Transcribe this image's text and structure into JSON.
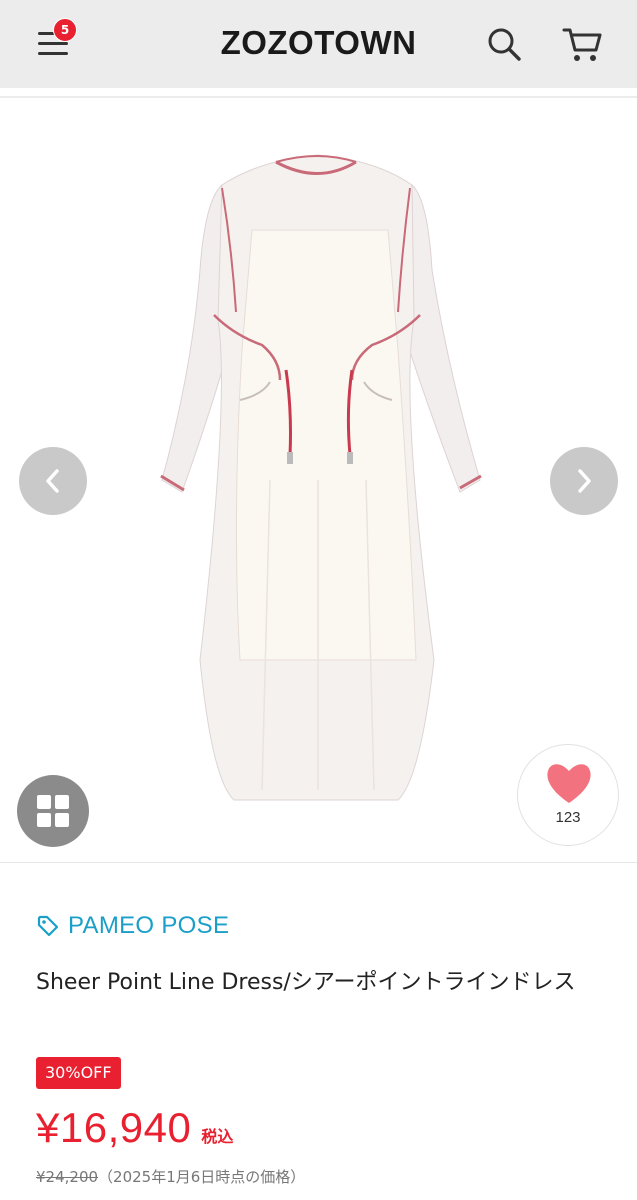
{
  "header": {
    "logo": "ZOZOTOWN",
    "menu_badge": "5"
  },
  "gallery": {
    "favorite_count": "123"
  },
  "product": {
    "brand": "PAMEO POSE",
    "title": "Sheer Point Line Dress/シアーポイントラインドレス",
    "discount_badge": "30%OFF",
    "price": "¥16,940",
    "tax_label": "税込",
    "original_price": "¥24,200",
    "original_price_note": "（2025年1月6日時点の価格）"
  },
  "colors": {
    "accent_red": "#e8202f",
    "brand_blue": "#1a9fc9",
    "header_bg": "#ececec",
    "heart": "#f2737f"
  }
}
